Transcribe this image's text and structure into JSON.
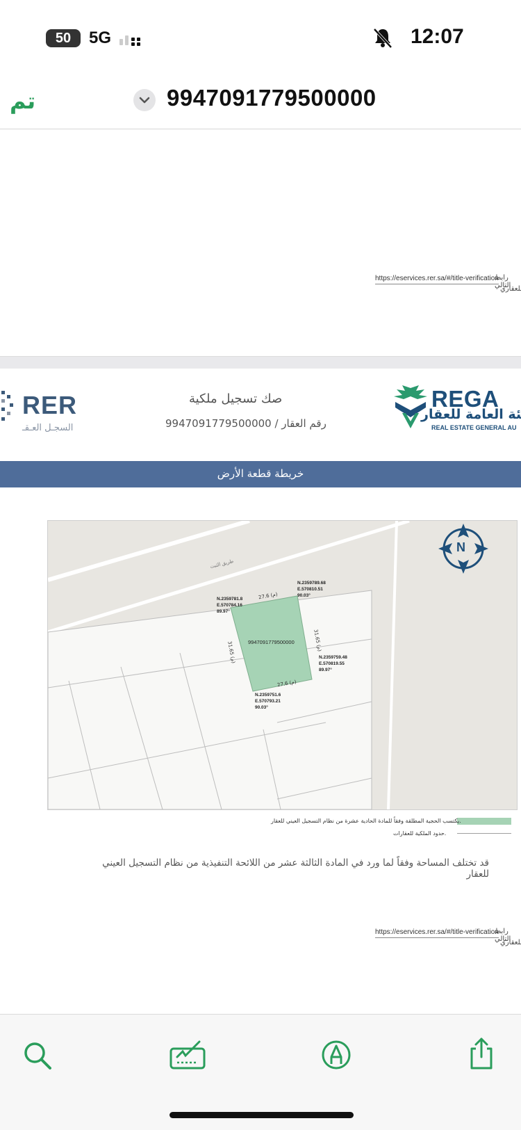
{
  "status_bar": {
    "battery": "50",
    "network": "5G",
    "time": "12:07"
  },
  "nav": {
    "done_label": "تم",
    "document_title": "9947091779500000"
  },
  "page1_footer": {
    "link_text": "https://eservices.rer.sa/#/title-verification",
    "link_prefix": "رابط التالي",
    "note": "للعقاري"
  },
  "header": {
    "deed_title": "صك تسجيل ملكية",
    "property_number": "رقم العقار / 9947091779500000",
    "rer_logo_text": "RER",
    "rer_logo_subtitle": "السجـل العـقـ",
    "rega_logo_text": "REGA",
    "rega_logo_arabic": "الهيئة العامة للعقار",
    "rega_logo_english": "REAL ESTATE GENERAL AU"
  },
  "section_title": "خريطة قطعة الأرض",
  "map": {
    "parcel_number": "9947091779500000",
    "street_name": "طريق الثبت",
    "north_label": "N",
    "sides": [
      "27.6 (م)",
      "31.65 (م)",
      "27.6 (م)",
      "31.65 (م)"
    ],
    "corners": [
      {
        "n": "N.2359781.8",
        "e": "E.570784.16",
        "angle": "89.97°"
      },
      {
        "n": "N.2359789.68",
        "e": "E.570810.51",
        "angle": "90.03°"
      },
      {
        "n": "N.2359759.48",
        "e": "E.570819.55",
        "angle": "89.97°"
      },
      {
        "n": "N.2359751.6",
        "e": "E.570793.21",
        "angle": "90.03°"
      }
    ],
    "legend": [
      {
        "label": "يكتسب الحجية المطلقة وفقاً للمادة الحادية عشرة من نظام التسجيل العيني للعقار.",
        "color": "#a6d3b5"
      },
      {
        "label": "حدود الملكية للعقارات.",
        "color": "#a0a0a0"
      }
    ]
  },
  "note": "قد تختلف المساحة وفقاً لما ورد في المادة الثالثة عشر من اللائحة التنفيذية من نظام التسجيل العيني للعقار",
  "page2_footer": {
    "link_text": "https://eservices.rer.sa/#/title-verification",
    "link_prefix": "رابط التالي",
    "note": "للعقاري"
  },
  "toolbar": {
    "items": [
      "search-icon",
      "signature-icon",
      "markup-icon",
      "share-icon"
    ],
    "accent_color": "#2a9d5b"
  }
}
